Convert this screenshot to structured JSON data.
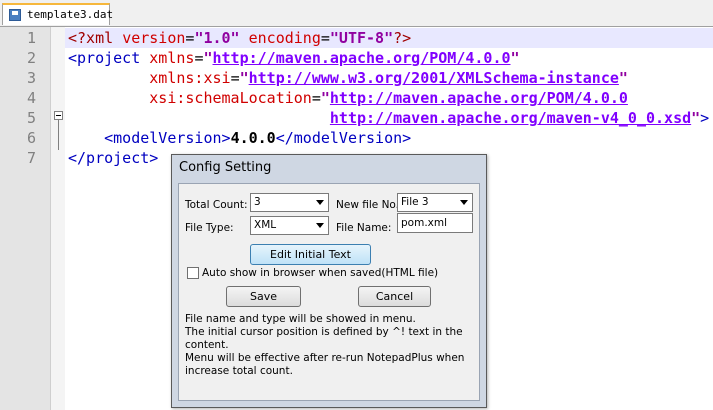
{
  "tab": {
    "label": "template3.dat"
  },
  "editor": {
    "line_numbers": [
      "1",
      "2",
      "3",
      "4",
      "5",
      "6",
      "7"
    ],
    "lines": [
      [
        {
          "cls": "t-pi",
          "text": "<?xml "
        },
        {
          "cls": "t-attr",
          "text": "version"
        },
        {
          "cls": "t-eq",
          "text": "="
        },
        {
          "cls": "t-val",
          "text": "\"1.0\""
        },
        {
          "cls": "t-attr",
          "text": " encoding"
        },
        {
          "cls": "t-eq",
          "text": "="
        },
        {
          "cls": "t-val",
          "text": "\"UTF-8\""
        },
        {
          "cls": "t-pi",
          "text": "?>"
        }
      ],
      [
        {
          "cls": "t-tag",
          "text": "<project "
        },
        {
          "cls": "t-attr",
          "text": "xmlns"
        },
        {
          "cls": "t-eq",
          "text": "="
        },
        {
          "cls": "t-val",
          "text": "\""
        },
        {
          "cls": "t-url",
          "text": "http://maven.apache.org/POM/4.0.0"
        },
        {
          "cls": "t-val",
          "text": "\""
        }
      ],
      [
        {
          "cls": "t-txt",
          "text": "         "
        },
        {
          "cls": "t-attr",
          "text": "xmlns:xsi"
        },
        {
          "cls": "t-eq",
          "text": "="
        },
        {
          "cls": "t-val",
          "text": "\""
        },
        {
          "cls": "t-url",
          "text": "http://www.w3.org/2001/XMLSchema-instance"
        },
        {
          "cls": "t-val",
          "text": "\""
        }
      ],
      [
        {
          "cls": "t-txt",
          "text": "         "
        },
        {
          "cls": "t-attr",
          "text": "xsi:schemaLocation"
        },
        {
          "cls": "t-eq",
          "text": "="
        },
        {
          "cls": "t-val",
          "text": "\""
        },
        {
          "cls": "t-url",
          "text": "http://maven.apache.org/POM/4.0.0"
        }
      ],
      [
        {
          "cls": "t-txt",
          "text": "                             "
        },
        {
          "cls": "t-url",
          "text": "http://maven.apache.org/maven-v4_0_0.xsd"
        },
        {
          "cls": "t-val",
          "text": "\""
        },
        {
          "cls": "t-tag",
          "text": ">"
        }
      ],
      [
        {
          "cls": "t-txt",
          "text": "    "
        },
        {
          "cls": "t-tag",
          "text": "<modelVersion>"
        },
        {
          "cls": "t-txt",
          "text": "4.0.0"
        },
        {
          "cls": "t-tag",
          "text": "</modelVersion>"
        }
      ],
      [
        {
          "cls": "t-tag",
          "text": "</project>"
        }
      ]
    ]
  },
  "dialog": {
    "title": "Config Setting",
    "total_count_label": "Total Count:",
    "total_count_value": "3",
    "new_file_no_label": "New file No.",
    "new_file_no_value": "File 3",
    "file_type_label": "File Type:",
    "file_type_value": "XML",
    "file_name_label": "File Name:",
    "file_name_value": "pom.xml",
    "edit_initial_text_label": "Edit Initial Text",
    "auto_show_label": "Auto show in browser when saved(HTML file)",
    "save_label": "Save",
    "cancel_label": "Cancel",
    "info_line1": "File name and type will be showed in menu.",
    "info_line2": "The initial cursor position is defined by ^! text in the",
    "info_line3": "content.",
    "info_line4": "Menu will be effective after re-run NotepadPlus when",
    "info_line5": "increase total count."
  }
}
